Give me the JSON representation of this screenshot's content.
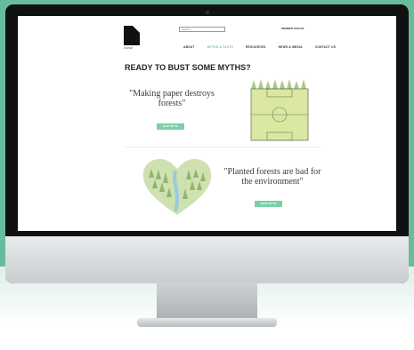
{
  "site": {
    "logo_text": "PAPER",
    "search_placeholder": "Search",
    "member_link": "MEMBER SIGN IN",
    "nav": [
      "ABOUT",
      "MYTHS & FACTS",
      "RESOURCES",
      "NEWS & MEDIA",
      "CONTACT US"
    ],
    "active_nav_index": 1,
    "heading": "READY TO BUST SOME MYTHS?",
    "myths": [
      {
        "quote": "\"Making paper destroys forests\"",
        "button": "BUST MYTH"
      },
      {
        "quote": "\"Planted forests are bad for the environment\"",
        "button": "BUST MYTH"
      }
    ]
  },
  "colors": {
    "background": "#67bc9e",
    "accent": "#7ccfa6",
    "field_green": "#dbe8a2"
  },
  "icons": [
    "logo-icon",
    "soccer-field-illustration",
    "heart-forest-illustration"
  ]
}
